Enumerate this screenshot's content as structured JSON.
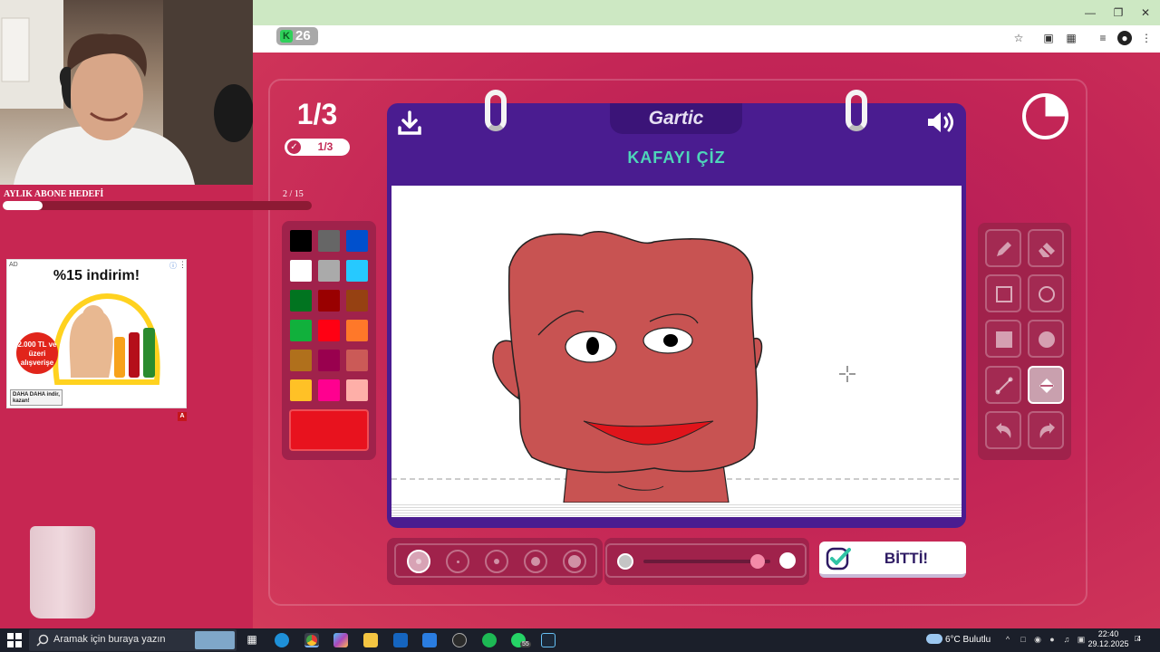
{
  "browser": {
    "badge_count": "26",
    "badge_letter": "K"
  },
  "stream": {
    "sub_goal_label": "AYLIK ABONE HEDEFİ",
    "sub_goal_count": "2 / 15",
    "sub_goal_progress": 0.13,
    "ad": {
      "tag": "AD",
      "headline": "%15 indirim!",
      "burst_text": "2.000 TL ve üzeri alışverişe",
      "brand_text": "DAHA DAHA indir, kazan!",
      "corner": "A"
    }
  },
  "game": {
    "round_counter": "1/3",
    "round_pill": "1/3",
    "logo": "Gartic",
    "task_title": "KAFAYI ÇİZ",
    "done_label": "BİTTİ!",
    "timer_fraction": 0.25,
    "opacity_level": 0.9,
    "palette": [
      "#000000",
      "#666666",
      "#0050cd",
      "#ffffff",
      "#aaaaaa",
      "#26c9ff",
      "#017420",
      "#990000",
      "#964112",
      "#11b03c",
      "#ff0013",
      "#ff7829",
      "#b0701c",
      "#99004e",
      "#cb5a57",
      "#ffc126",
      "#ff008f",
      "#feafa8"
    ],
    "current_color": "#e8121e",
    "tools": [
      "pencil",
      "eraser",
      "rectangle-outline",
      "ellipse-outline",
      "rectangle-filled",
      "ellipse-filled",
      "line",
      "fill-bucket",
      "undo",
      "redo"
    ],
    "active_tool": "fill-bucket",
    "brush_sizes": 5,
    "selected_brush_size": 1
  },
  "taskbar": {
    "search_placeholder": "Aramak için buraya yazın",
    "weather": "6°C  Bulutlu",
    "time": "22:40",
    "date": "29.12.2025",
    "whatsapp_badge": "55",
    "notification_count": "4"
  }
}
